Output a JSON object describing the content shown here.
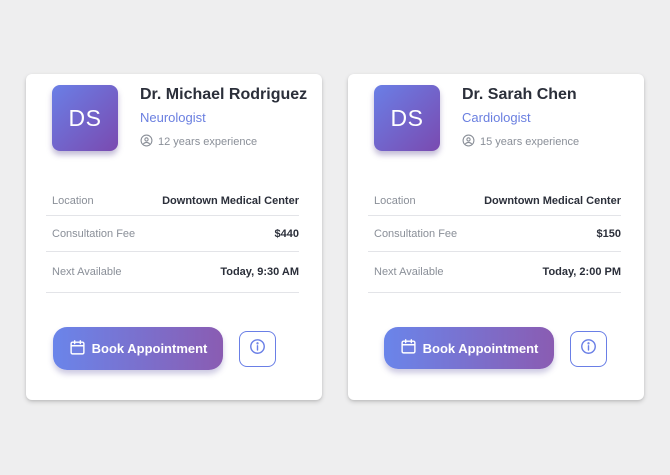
{
  "colors": {
    "accent": "#6a7fe0",
    "gradient_start": "#6a85ea",
    "gradient_end": "#8a5cb2",
    "text_dark": "#2b2f3a",
    "text_muted": "#8a8f98"
  },
  "cards": [
    {
      "initials": "DS",
      "name": "Dr. Michael Rodriguez",
      "specialty": "Neurologist",
      "experience": "12 years experience",
      "details": [
        {
          "label": "Location",
          "value": "Downtown Medical Center"
        },
        {
          "label": "Consultation Fee",
          "value": "$440"
        },
        {
          "label": "Next Available",
          "value": "Today, 9:30 AM"
        }
      ],
      "book_label": "Book Appointment",
      "icons": {
        "experience": "user-circle-icon",
        "book": "calendar-icon",
        "info": "info-icon"
      }
    },
    {
      "initials": "DS",
      "name": "Dr. Sarah Chen",
      "specialty": "Cardiologist",
      "experience": "15 years experience",
      "details": [
        {
          "label": "Location",
          "value": "Downtown Medical Center"
        },
        {
          "label": "Consultation Fee",
          "value": "$150"
        },
        {
          "label": "Next Available",
          "value": "Today, 2:00 PM"
        }
      ],
      "book_label": "Book Appointment",
      "icons": {
        "experience": "user-circle-icon",
        "book": "calendar-icon",
        "info": "info-icon"
      }
    }
  ]
}
